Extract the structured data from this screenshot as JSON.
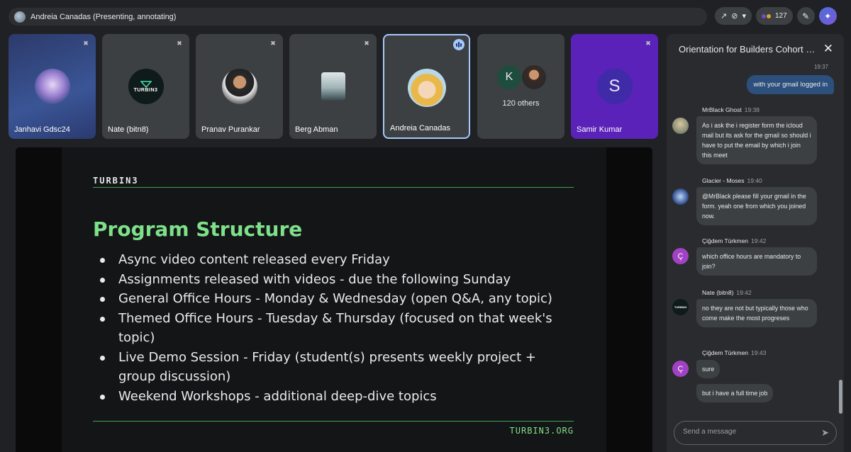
{
  "topbar": {
    "presenter_label": "Andreia Canadas (Presenting, annotating)",
    "participant_count": "127"
  },
  "tiles": [
    {
      "name": "Janhavi Gdsc24"
    },
    {
      "name": "Nate (bitn8)",
      "logo_text": "TURBIN3"
    },
    {
      "name": "Pranav Purankar"
    },
    {
      "name": "Berg Abman"
    },
    {
      "name": "Andreia Canadas"
    },
    {
      "others_label": "120 others",
      "initial": "K"
    },
    {
      "name": "Samir Kumar",
      "initial": "S"
    }
  ],
  "slide": {
    "brand_top": "TURBIN3",
    "title": "Program Structure",
    "bullets": [
      "Async video content released every Friday",
      "Assignments released with videos - due the following Sunday",
      "General Office Hours - Monday & Wednesday (open Q&A, any topic)",
      "Themed Office Hours - Tuesday & Thursday (focused on that week's topic)",
      "Live Demo Session - Friday (student(s) presents weekly project + group discussion)",
      "Weekend Workshops - additional deep-dive topics"
    ],
    "brand_bottom": "TURBIN3.ORG"
  },
  "chat": {
    "title": "Orientation for Builders Cohort Q...",
    "own_time": "19:37",
    "own_message": "with your gmail logged in",
    "messages": [
      {
        "sender": "MrBlack Ghost",
        "time": "19:38",
        "text": "As i ask the i register form the icloud mail but its ask for the gmail so should i have to put the email by which i join this meet"
      },
      {
        "sender": "Glacier - Moses",
        "time": "19:40",
        "text": "@MrBlack please fill your gmail in the form. yeah one from which you joined now."
      },
      {
        "sender": "Çiğdem Türkmen",
        "time": "19:42",
        "text": "which office hours are mandatory to join?",
        "initial": "Ç"
      },
      {
        "sender": "Nate (bitn8)",
        "time": "19:42",
        "text": "no they are not but typically those who come make the most progreses",
        "logo_text": "TURBIN3"
      },
      {
        "sender": "Çiğdem Türkmen",
        "time": "19:43",
        "text": "sure",
        "text2": "but i have a full time job",
        "initial": "Ç"
      }
    ],
    "input_placeholder": "Send a message"
  },
  "colors": {
    "accent_green": "#7ee08a",
    "chat_own_bubble": "#2c4f7c",
    "samir_tile": "#5a22b8"
  }
}
